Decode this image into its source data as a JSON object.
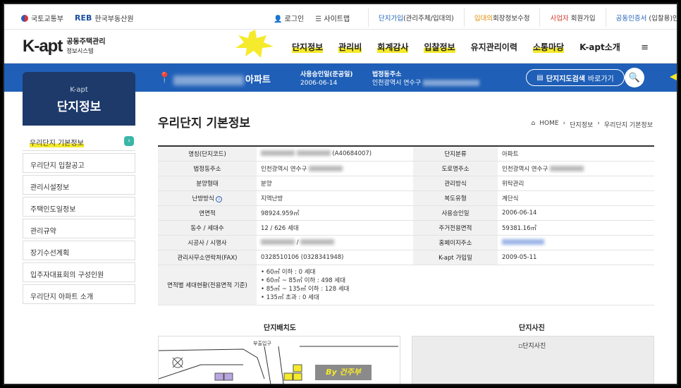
{
  "util": {
    "gov": "국토교통부",
    "reb_mark": "REB",
    "reb": "한국부동산원",
    "login": "로그인",
    "sitemap": "사이트맵",
    "tab1_a": "단지가입",
    "tab1_b": "(관리주체/입대의)",
    "tab2_a": "입대의",
    "tab2_b": "회장정보수정",
    "tab3_a": "사업자",
    "tab3_b": " 회원가입",
    "tab4_a": "공동인증서",
    "tab4_b": " (입찰용)안내"
  },
  "header": {
    "logo_k": "K-apt",
    "logo_line1": "공동주택관리",
    "logo_line2": "정보시스템",
    "nav": [
      "단지정보",
      "관리비",
      "회계감사",
      "입찰정보",
      "유지관리이력",
      "소통마당",
      "K-apt소개"
    ],
    "menu_icon": "≡"
  },
  "band": {
    "apt_suffix": "아파트",
    "approval_label": "사용승인일(준공일)",
    "approval_value": "2006-06-14",
    "address_label": "법정동주소",
    "address_value": "인천광역시 연수구",
    "map_label": "단지지도검색",
    "map_suffix": " 바로가기"
  },
  "sidebar": {
    "card_small": "K-apt",
    "card_title": "단지정보",
    "items": [
      "우리단지 기본정보",
      "우리단지 입찰공고",
      "관리시설정보",
      "주택인도일정보",
      "관리규약",
      "장기수선계획",
      "입주자대표회의 구성인원",
      "우리단지 아파트 소개"
    ],
    "go": "›"
  },
  "main": {
    "title": "우리단지 기본정보",
    "crumbs": [
      "HOME",
      "›",
      "단지정보",
      "›",
      "우리단지 기본정보"
    ]
  },
  "table": {
    "r1": {
      "k1": "명칭(단지코드)",
      "v1": "(A40684007)",
      "k2": "단지분류",
      "v2": "아파트"
    },
    "r2": {
      "k1": "법정동주소",
      "v1": "인천광역시 연수구",
      "k2": "도로명주소",
      "v2": "인천광역시 연수구"
    },
    "r3": {
      "k1": "분양형태",
      "v1": "분양",
      "k2": "관리방식",
      "v2": "위탁관리"
    },
    "r4": {
      "k1": "난방방식",
      "v1": "지역난방",
      "k2": "복도유형",
      "v2": "계단식"
    },
    "r5": {
      "k1": "연면적",
      "v1": "98924.959㎡",
      "k2": "사용승인일",
      "v2": "2006-06-14"
    },
    "r6": {
      "k1": "동수 / 세대수",
      "v1": "12 / 626 세대",
      "k2": "주거전용면적",
      "v2": "59381.16㎡"
    },
    "r7": {
      "k1": "시공사 / 시행사",
      "v1": "/",
      "k2": "홈페이지주소",
      "v2": ""
    },
    "r8": {
      "k1": "관리사무소연락처(FAX)",
      "v1": "0328510106 (0328341948)",
      "k2": "K-apt 가입일",
      "v2": "2009-05-11"
    },
    "r9": {
      "k1": "면적별 세대현황(전용면적 기준)",
      "list": [
        "60㎡ 이하 : 0 세대",
        "60㎡ ~ 85㎡ 이하 : 498 세대",
        "85㎡ ~ 135㎡ 이하 : 128 세대",
        "135㎡ 초과 : 0 세대"
      ]
    }
  },
  "sections": {
    "map_title": "단지배치도",
    "photo_title": "단지사진",
    "photo_alt": "단지사진",
    "map_label": "부출입구",
    "watermark": "By 건주부"
  }
}
